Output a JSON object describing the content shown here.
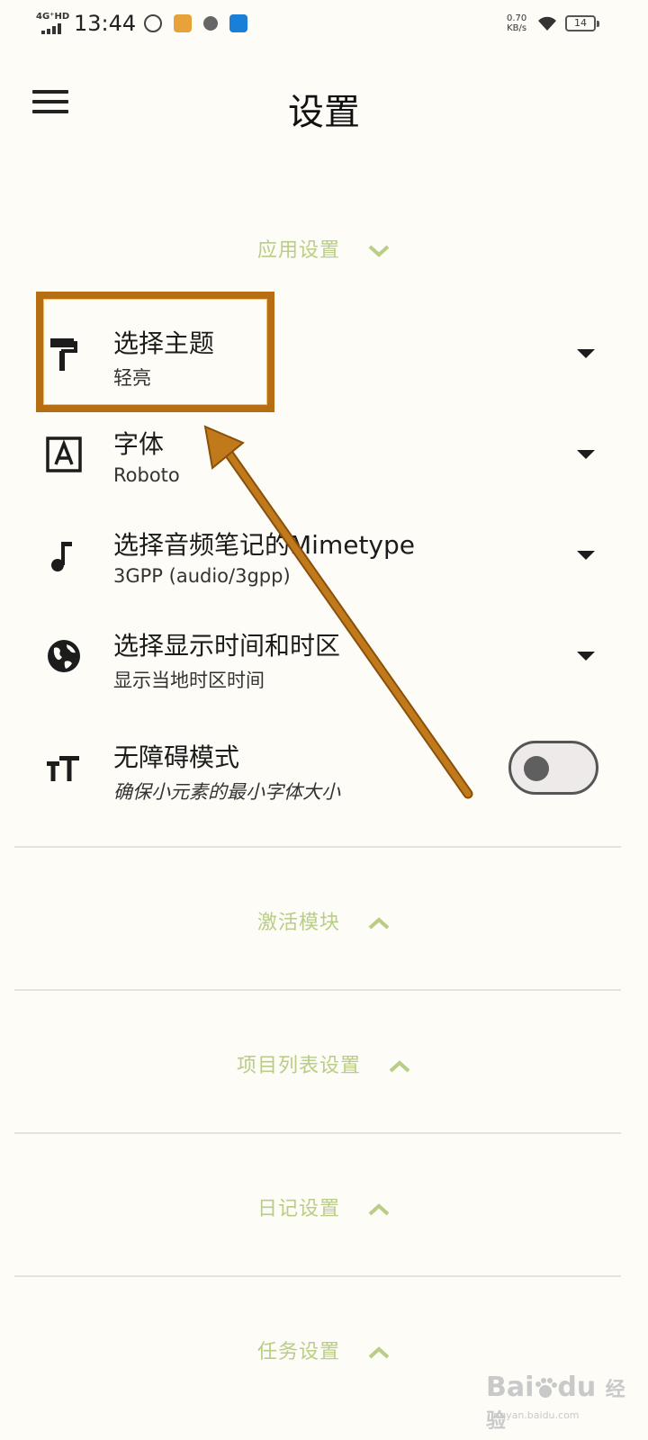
{
  "status_bar": {
    "network": "4G⁺HD",
    "time": "13:44",
    "speed_value": "0.70",
    "speed_unit": "KB/s",
    "battery": "14"
  },
  "header": {
    "title": "设置",
    "menu_icon": "hamburger-menu-icon"
  },
  "sections": {
    "app_settings": "应用设置",
    "activate_modules": "激活模块",
    "project_list": "项目列表设置",
    "diary": "日记设置",
    "task": "任务设置"
  },
  "settings": {
    "theme": {
      "title": "选择主题",
      "value": "轻亮",
      "icon": "paint-roller-icon"
    },
    "font": {
      "title": "字体",
      "value": "Roboto",
      "icon": "font-icon"
    },
    "audio_mimetype": {
      "title": "选择音频笔记的Mimetype",
      "value": "3GPP (audio/3gpp)",
      "icon": "music-note-icon"
    },
    "timezone": {
      "title": "选择显示时间和时区",
      "value": "显示当地时区时间",
      "icon": "globe-icon"
    },
    "accessibility": {
      "title": "无障碍模式",
      "value": "确保小元素的最小字体大小",
      "icon": "text-size-icon",
      "enabled": false
    }
  },
  "colors": {
    "accent": "#b9cd86",
    "annotation": "#b76e13",
    "background": "#fdfcf6"
  },
  "watermark": {
    "brand": "Bai",
    "brand2": "du",
    "cn": "经验",
    "url": "jingyan.baidu.com"
  }
}
